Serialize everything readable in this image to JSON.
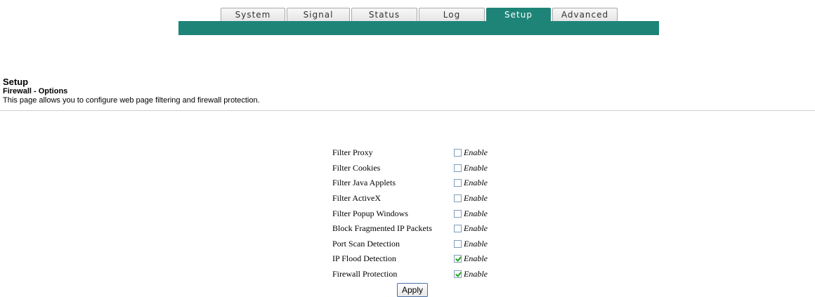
{
  "nav": {
    "tabs": [
      {
        "label": "System",
        "active": false
      },
      {
        "label": "Signal",
        "active": false
      },
      {
        "label": "Status",
        "active": false
      },
      {
        "label": "Log",
        "active": false
      },
      {
        "label": "Setup",
        "active": true
      },
      {
        "label": "Advanced",
        "active": false
      }
    ],
    "accent_color": "#1f8478"
  },
  "header": {
    "title": "Setup",
    "subtitle": "Firewall - Options",
    "description": "This page allows you to configure web page filtering and firewall protection."
  },
  "options": [
    {
      "label": "Filter Proxy",
      "enable_label": "Enable",
      "checked": false
    },
    {
      "label": "Filter Cookies",
      "enable_label": "Enable",
      "checked": false
    },
    {
      "label": "Filter Java Applets",
      "enable_label": "Enable",
      "checked": false
    },
    {
      "label": "Filter ActiveX",
      "enable_label": "Enable",
      "checked": false
    },
    {
      "label": "Filter Popup Windows",
      "enable_label": "Enable",
      "checked": false
    },
    {
      "label": "Block Fragmented IP Packets",
      "enable_label": "Enable",
      "checked": false
    },
    {
      "label": "Port Scan Detection",
      "enable_label": "Enable",
      "checked": false
    },
    {
      "label": "IP Flood Detection",
      "enable_label": "Enable",
      "checked": true
    },
    {
      "label": "Firewall Protection",
      "enable_label": "Enable",
      "checked": true
    }
  ],
  "apply_label": "Apply"
}
